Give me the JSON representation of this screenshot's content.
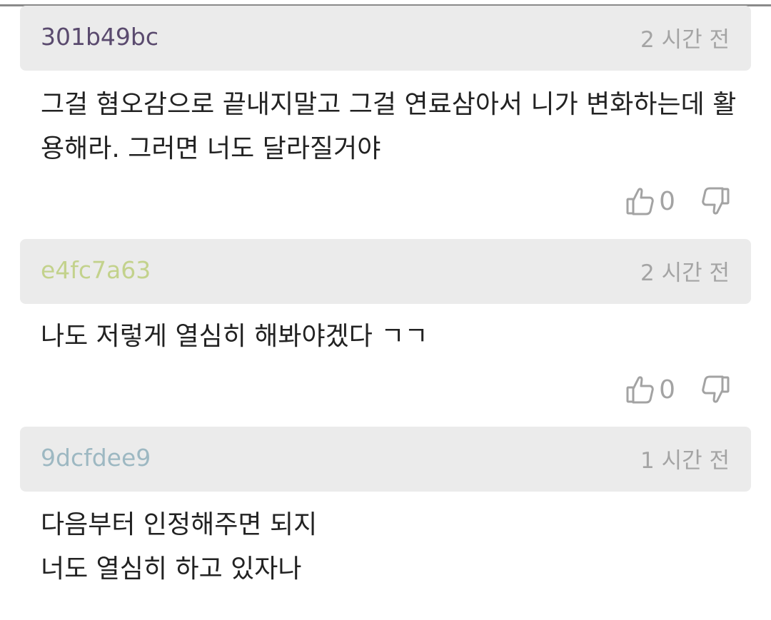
{
  "comments": [
    {
      "author": "301b49bc",
      "author_color": "#5a4a6e",
      "time": "2 시간 전",
      "text": "그걸 혐오감으로 끝내지말고 그걸 연료삼아서 니가 변화하는데 활\n용해라. 그러면 너도 달라질거야",
      "like_count": "0",
      "like_icon": "thumbs-up-icon",
      "dislike_icon": "thumbs-down-icon"
    },
    {
      "author": "e4fc7a63",
      "author_color": "#c3d28c",
      "time": "2 시간 전",
      "text": "나도 저렇게 열심히 해봐야겠다 ㄱㄱ",
      "like_count": "0",
      "like_icon": "thumbs-up-icon",
      "dislike_icon": "thumbs-down-icon"
    },
    {
      "author": "9dcfdee9",
      "author_color": "#9db8c2",
      "time": "1 시간 전",
      "text": "다음부터 인정해주면 되지\n너도 열심히 하고 있자나"
    }
  ]
}
